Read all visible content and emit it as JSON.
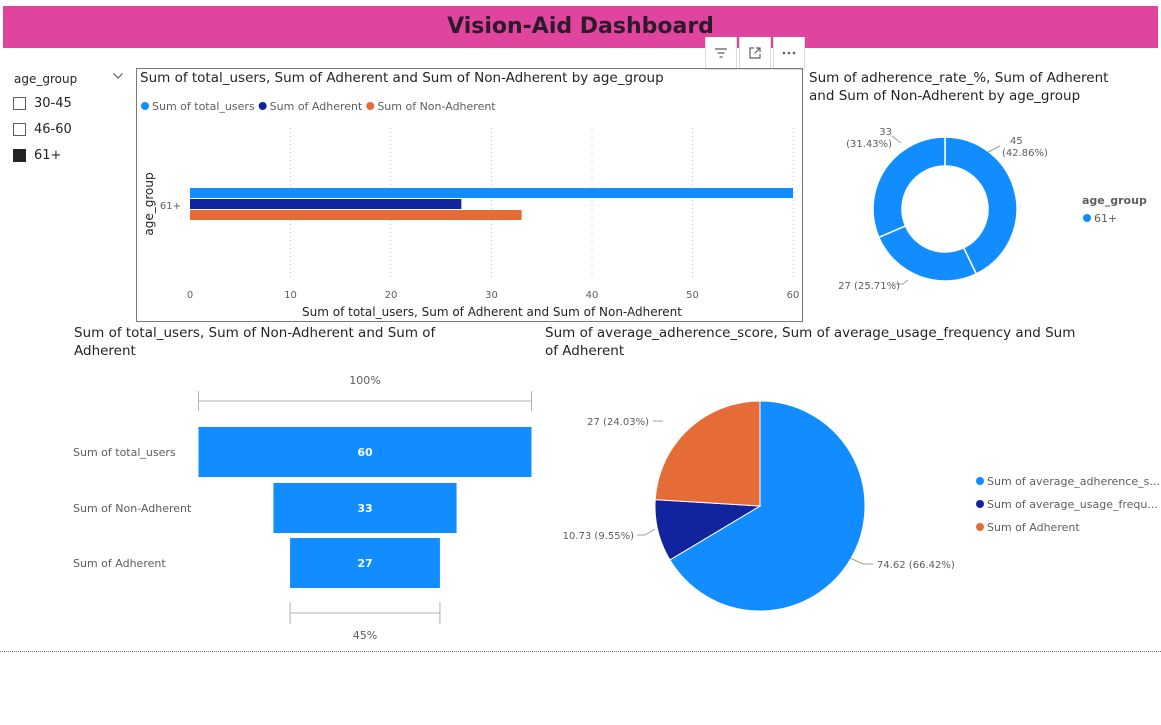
{
  "page": {
    "title": "Vision-Aid Dashboard"
  },
  "header_icons": [
    "filter-icon",
    "focus-mode-icon",
    "more-options-icon"
  ],
  "slicer": {
    "title": "age_group",
    "items": [
      {
        "label": "30-45",
        "checked": false
      },
      {
        "label": "46-60",
        "checked": false
      },
      {
        "label": "61+",
        "checked": true
      }
    ]
  },
  "colors": {
    "blue": "#118dff",
    "navy": "#12239e",
    "orange": "#e66c37",
    "header": "#e0449f"
  },
  "chart_data": [
    {
      "type": "bar",
      "orientation": "horizontal",
      "title": "Sum of total_users, Sum of Adherent and Sum of Non-Adherent by age_group",
      "xlabel": "Sum of total_users, Sum of Adherent and Sum of Non-Adherent",
      "ylabel": "age_group",
      "categories": [
        "61+"
      ],
      "series": [
        {
          "name": "Sum of total_users",
          "values": [
            60
          ],
          "color": "#118dff"
        },
        {
          "name": "Sum of Adherent",
          "values": [
            27
          ],
          "color": "#12239e"
        },
        {
          "name": "Sum of Non-Adherent",
          "values": [
            33
          ],
          "color": "#e66c37"
        }
      ],
      "xlim": [
        0,
        60
      ],
      "xticks": [
        "0",
        "10",
        "20",
        "30",
        "40",
        "50",
        "60"
      ],
      "legend": "top-left",
      "grid": true
    },
    {
      "type": "pie",
      "subtype": "donut",
      "title": "Sum of adherence_rate_%, Sum of Adherent and Sum of Non-Adherent by age_group",
      "legend_title": "age_group",
      "legend_items": [
        "61+"
      ],
      "slices": [
        {
          "value": 45,
          "label_value": "45",
          "label_pct": "(42.86%)",
          "color": "#118dff"
        },
        {
          "value": 27,
          "label_value": "27 (25.71%)",
          "label_pct": "",
          "color": "#118dff"
        },
        {
          "value": 33,
          "label_value": "33",
          "label_pct": "(31.43%)",
          "color": "#118dff"
        }
      ]
    },
    {
      "type": "funnel",
      "title": "Sum of total_users, Sum of Non-Adherent and Sum of Adherent",
      "categories": [
        "Sum of total_users",
        "Sum of Non-Adherent",
        "Sum of Adherent"
      ],
      "values": [
        60,
        33,
        27
      ],
      "value_labels": [
        "60",
        "33",
        "27"
      ],
      "top_pct": "100%",
      "bottom_pct": "45%",
      "color": "#118dff"
    },
    {
      "type": "pie",
      "title": "Sum of average_adherence_score, Sum of average_usage_frequency and Sum of Adherent",
      "legend": "right",
      "slices": [
        {
          "name": "Sum of average_adherence_s...",
          "value": 74.62,
          "label": "74.62 (66.42%)",
          "color": "#118dff"
        },
        {
          "name": "Sum of average_usage_frequ...",
          "value": 10.73,
          "label": "10.73 (9.55%)",
          "color": "#12239e"
        },
        {
          "name": "Sum of Adherent",
          "value": 27,
          "label": "27 (24.03%)",
          "color": "#e66c37"
        }
      ]
    }
  ]
}
